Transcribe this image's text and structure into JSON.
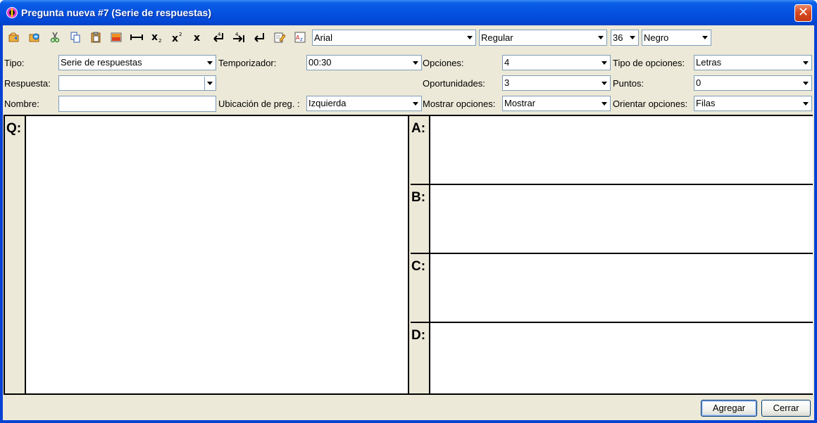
{
  "window": {
    "title": "Pregunta nueva #7 (Serie de respuestas)",
    "close_glyph": "✕"
  },
  "toolbar": {
    "icons": [
      "open-icon",
      "import-icon",
      "cut-icon",
      "copy-icon",
      "paste-icon",
      "image-icon",
      "line-icon",
      "subscript-icon",
      "superscript-icon",
      "remove-format-icon",
      "enter-icon",
      "tab-icon",
      "return-icon",
      "edit-icon",
      "sort-icon"
    ],
    "font_value": "Arial",
    "style_value": "Regular",
    "size_value": "36",
    "color_value": "Negro"
  },
  "form": {
    "tipo_label": "Tipo:",
    "tipo_value": "Serie de respuestas",
    "temporizador_label": "Temporizador:",
    "temporizador_value": "00:30",
    "opciones_label": "Opciones:",
    "opciones_value": "4",
    "tipo_opciones_label": "Tipo de opciones:",
    "tipo_opciones_value": "Letras",
    "respuesta_label": "Respuesta:",
    "respuesta_value": "",
    "oportunidades_label": "Oportunidades:",
    "oportunidades_value": "3",
    "puntos_label": "Puntos:",
    "puntos_value": "0",
    "nombre_label": "Nombre:",
    "nombre_value": "",
    "ubicacion_label": "Ubicación de preg. :",
    "ubicacion_value": "Izquierda",
    "mostrar_label": "Mostrar opciones:",
    "mostrar_value": "Mostrar",
    "orientar_label": "Orientar opciones:",
    "orientar_value": "Filas"
  },
  "content": {
    "question_label": "Q:",
    "options": [
      {
        "letter": "A:"
      },
      {
        "letter": "B:"
      },
      {
        "letter": "C:"
      },
      {
        "letter": "D:"
      }
    ]
  },
  "footer": {
    "add_label": "Agregar",
    "close_label": "Cerrar"
  }
}
